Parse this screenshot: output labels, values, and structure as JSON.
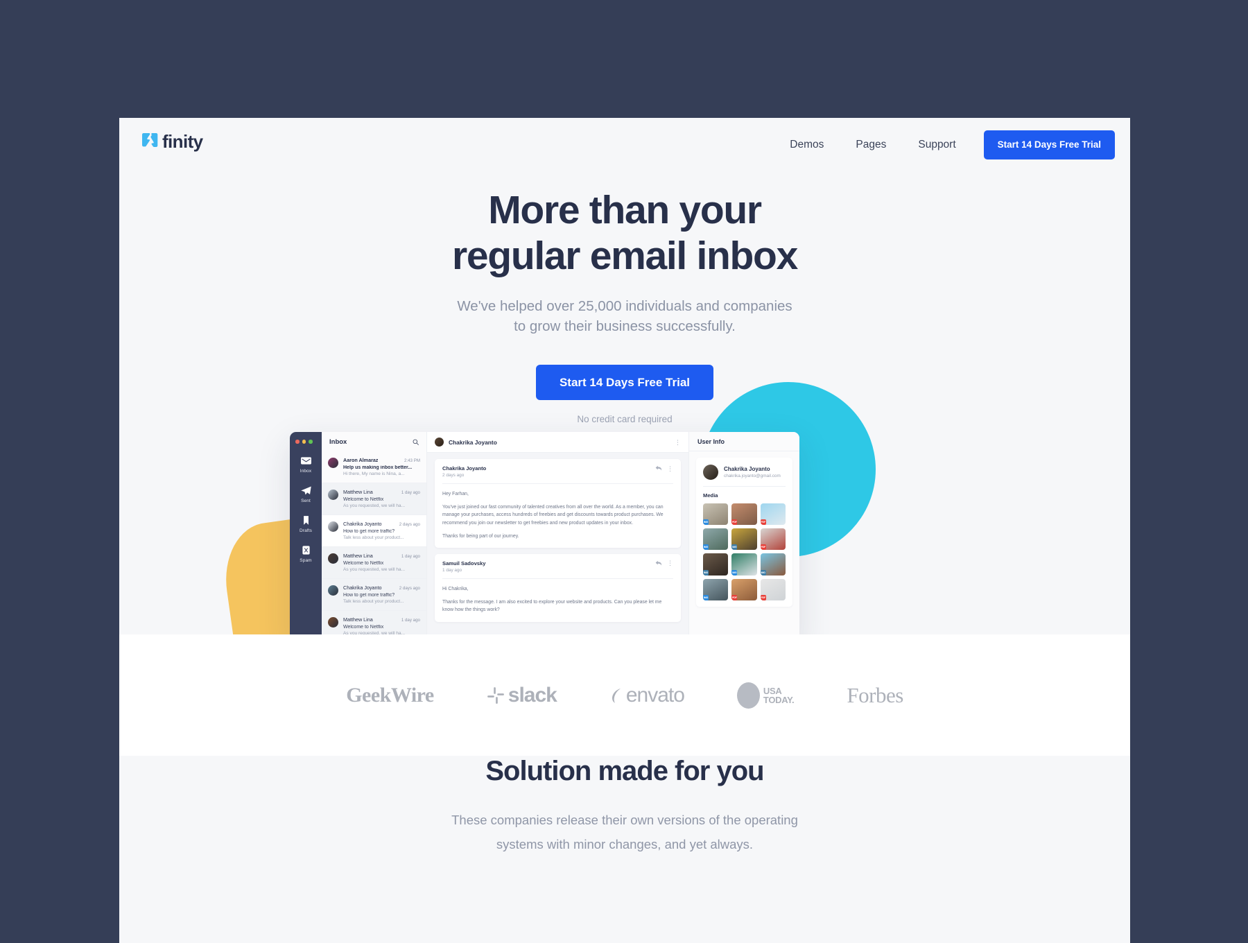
{
  "theme": {
    "page_bg": "#353e57",
    "surface": "#f6f7f9",
    "accent_blue": "#1e5bf0",
    "accent_cyan": "#2ec8e6",
    "accent_yellow": "#f5c45e",
    "ink": "#28304a",
    "muted": "#8b93a5"
  },
  "header": {
    "logo_text": "finity",
    "logo_icon": "finity-mark-icon",
    "nav": [
      {
        "label": "Demos"
      },
      {
        "label": "Pages"
      },
      {
        "label": "Support"
      }
    ],
    "cta_label": "Start 14 Days Free Trial"
  },
  "hero": {
    "title_line1": "More than your",
    "title_line2": "regular email inbox",
    "subtitle_line1": "We've helped over 25,000 individuals and companies",
    "subtitle_line2": "to grow their business successfully.",
    "cta_label": "Start 14 Days Free Trial",
    "note": "No credit card required"
  },
  "app_mock": {
    "window_dots": [
      "red",
      "yellow",
      "green"
    ],
    "sidebar": [
      {
        "label": "Inbox",
        "icon": "envelope-icon"
      },
      {
        "label": "Sent",
        "icon": "paper-plane-icon"
      },
      {
        "label": "Drafts",
        "icon": "bookmark-icon"
      },
      {
        "label": "Spam",
        "icon": "x-box-icon"
      }
    ],
    "list": {
      "title": "Inbox",
      "search_icon": "search-icon",
      "messages": [
        {
          "from": "Aaron Almaraz",
          "time": "2:43 PM",
          "subject": "Help us making inbox better...",
          "preview": "Hi there, My name is Nina, a...",
          "unread": true,
          "avatar": "#8e3a6b"
        },
        {
          "from": "Matthew Lina",
          "time": "1 day ago",
          "subject": "Welcome to Netflix",
          "preview": "As you requested, we will ha...",
          "unread": false,
          "avatar": "#b8c3cf"
        },
        {
          "from": "Chakrika Joyanto",
          "time": "2 days ago",
          "subject": "How to get more traffic?",
          "preview": "Talk less about your product...",
          "unread": false,
          "avatar": "#dfe3e9"
        },
        {
          "from": "Matthew Lina",
          "time": "1 day ago",
          "subject": "Welcome to Netflix",
          "preview": "As you requested, we will ha...",
          "unread": false,
          "avatar": "#4a3b34"
        },
        {
          "from": "Chakrika Joyanto",
          "time": "2 days ago",
          "subject": "How to get more traffic?",
          "preview": "Talk less about your product...",
          "unread": false,
          "avatar": "#5d7f93"
        },
        {
          "from": "Matthew Lina",
          "time": "1 day ago",
          "subject": "Welcome to Netflix",
          "preview": "As you requested, we will ha...",
          "unread": false,
          "avatar": "#7a4b2e"
        }
      ]
    },
    "reading": {
      "header_name": "Chakrika Joyanto",
      "messages": [
        {
          "from": "Chakrika Joyanto",
          "when": "2 days ago",
          "p1": "Hey Farhan,",
          "p2": "You've just joined our fast community of talented creatives from all over the world. As a member, you can manage your purchases, access hundreds of freebies and get discounts towards product purchases. We recommend you join our newsletter to get freebies and new product updates in your inbox.",
          "p3": "Thanks for being part of our journey."
        },
        {
          "from": "Samuil Sadovsky",
          "when": "1 day ago",
          "p1": "Hi Chakrika,",
          "p2": "Thanks for the message. I am also excited to explore your website and products. Can you please let me know how the things work?",
          "p3": ""
        }
      ]
    },
    "user_info": {
      "title": "User Info",
      "name": "Chakrika Joyanto",
      "email": "chakrika.joyanto@gmail.com",
      "status": "online",
      "media_title": "Media",
      "media": [
        {
          "badge": "IMG",
          "kind": "img",
          "c1": "#c9c3b4",
          "c2": "#8d8372"
        },
        {
          "badge": "PDF",
          "kind": "pdf",
          "c1": "#c48d6e",
          "c2": "#7d5b46"
        },
        {
          "badge": "PDF",
          "kind": "pdf",
          "c1": "#9ed6ef",
          "c2": "#dfe9ef"
        },
        {
          "badge": "IMG",
          "kind": "img",
          "c1": "#8fa9ab",
          "c2": "#4e6a5c"
        },
        {
          "badge": "IMG",
          "kind": "doc",
          "c1": "#c9a63e",
          "c2": "#4d4030"
        },
        {
          "badge": "PDF",
          "kind": "pdf",
          "c1": "#d8d6d3",
          "c2": "#b2433a"
        },
        {
          "badge": "IMG",
          "kind": "doc",
          "c1": "#6b5a4a",
          "c2": "#2e2620"
        },
        {
          "badge": "IMG",
          "kind": "img",
          "c1": "#2f7e66",
          "c2": "#dfe3e6"
        },
        {
          "badge": "IMG",
          "kind": "doc",
          "c1": "#79c4e2",
          "c2": "#8a5a3e"
        },
        {
          "badge": "IMG",
          "kind": "img",
          "c1": "#8ea4ad",
          "c2": "#44545c"
        },
        {
          "badge": "PDF",
          "kind": "pdf",
          "c1": "#d9a06a",
          "c2": "#8d5c3a"
        },
        {
          "badge": "PDF",
          "kind": "pdf",
          "c1": "#e7e7e7",
          "c2": "#cfd3d6"
        }
      ]
    }
  },
  "logo_bar": {
    "brands": [
      {
        "name": "GeekWire",
        "label": "GeekWire"
      },
      {
        "name": "slack",
        "label": "slack"
      },
      {
        "name": "envato",
        "label": "envato"
      },
      {
        "name": "usa-today",
        "label_top": "USA",
        "label_bottom": "TODAY."
      },
      {
        "name": "Forbes",
        "label": "Forbes"
      }
    ]
  },
  "solution": {
    "title": "Solution made for you",
    "body_line1": "These companies release their own versions of the operating",
    "body_line2": "systems with minor changes, and yet always."
  }
}
